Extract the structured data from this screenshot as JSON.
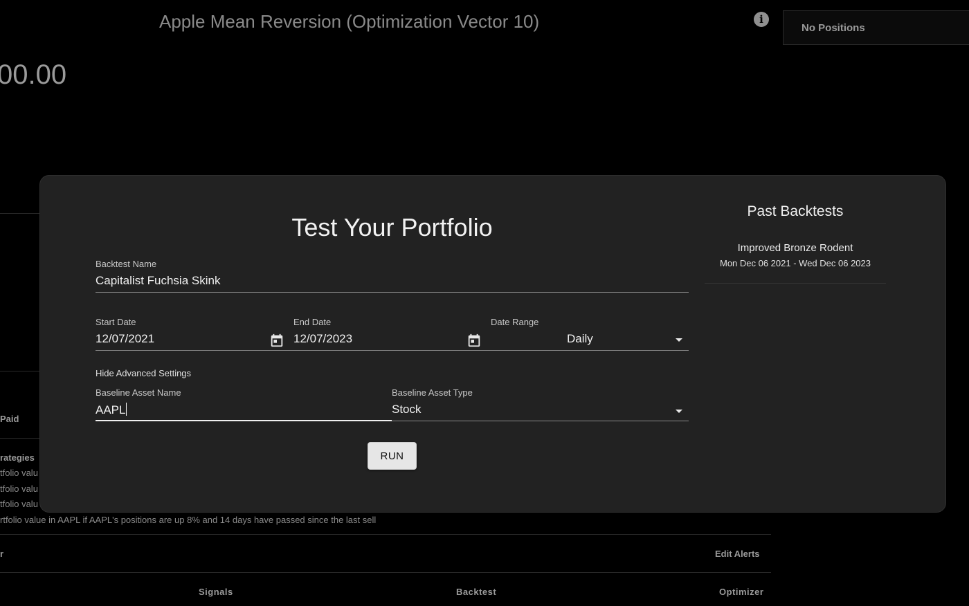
{
  "background": {
    "strategy_title": "Apple Mean Reversion (Optimization Vector 10)",
    "positions_label": "No Positions",
    "portfolio_value_partial": "00.00",
    "paid_label": "Paid",
    "strategies_label": "rategies",
    "strategy_lines": [
      "tfolio valu",
      "tfolio valu",
      "tfolio valu",
      "rtfolio value in AAPL if AAPL's positions are up 8% and 14 days have passed since the last sell"
    ],
    "alerts_row_left": "r",
    "edit_alerts_label": "Edit Alerts",
    "nav": {
      "signals": "Signals",
      "backtest": "Backtest",
      "optimizer": "Optimizer"
    }
  },
  "modal": {
    "title": "Test Your Portfolio",
    "backtest_name": {
      "label": "Backtest Name",
      "value": "Capitalist Fuchsia Skink"
    },
    "start_date": {
      "label": "Start Date",
      "value": "12/07/2021"
    },
    "end_date": {
      "label": "End Date",
      "value": "12/07/2023"
    },
    "date_range": {
      "label": "Date Range",
      "value": "Daily"
    },
    "advanced_toggle_label": "Hide Advanced Settings",
    "baseline_asset_name": {
      "label": "Baseline Asset Name",
      "value": "AAPL"
    },
    "baseline_asset_type": {
      "label": "Baseline Asset Type",
      "value": "Stock"
    },
    "run_label": "RUN",
    "past_backtests": {
      "title": "Past Backtests",
      "items": [
        {
          "name": "Improved Bronze Rodent",
          "dates": "Mon Dec 06 2021 - Wed Dec 06 2023"
        }
      ]
    }
  },
  "icons": {
    "info": "info-icon",
    "calendar": "calendar-icon",
    "dropdown": "caret-down-icon"
  },
  "colors": {
    "page_background": "#000000",
    "modal_background": "#222222",
    "button_background": "#e6e6e6"
  }
}
